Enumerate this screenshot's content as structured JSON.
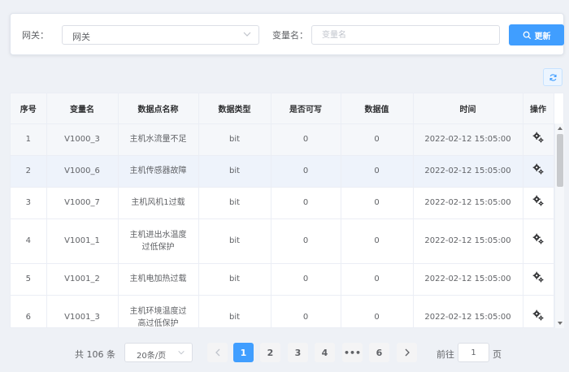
{
  "filter": {
    "gateway_label": "网关：",
    "gateway_value": "网关",
    "var_label": "变量名：",
    "var_placeholder": "变量名",
    "refresh_label": "更新"
  },
  "table": {
    "columns": [
      "序号",
      "变量名",
      "数据点名称",
      "数据类型",
      "是否可写",
      "数据值",
      "时间",
      "操作"
    ],
    "rows": [
      {
        "idx": "1",
        "var": "V1000_3",
        "name_lines": [
          "主机水流量不足"
        ],
        "type": "bit",
        "writable": "0",
        "value": "0",
        "time": "2022-02-12 15:05:00"
      },
      {
        "idx": "2",
        "var": "V1000_6",
        "name_lines": [
          "主机传感器故障"
        ],
        "type": "bit",
        "writable": "0",
        "value": "0",
        "time": "2022-02-12 15:05:00"
      },
      {
        "idx": "3",
        "var": "V1000_7",
        "name_lines": [
          "主机风机1过载"
        ],
        "type": "bit",
        "writable": "0",
        "value": "0",
        "time": "2022-02-12 15:05:00"
      },
      {
        "idx": "4",
        "var": "V1001_1",
        "name_lines": [
          "主机进出水温度",
          "过低保护"
        ],
        "type": "bit",
        "writable": "0",
        "value": "0",
        "time": "2022-02-12 15:05:00"
      },
      {
        "idx": "5",
        "var": "V1001_2",
        "name_lines": [
          "主机电加热过载"
        ],
        "type": "bit",
        "writable": "0",
        "value": "0",
        "time": "2022-02-12 15:05:00"
      },
      {
        "idx": "6",
        "var": "V1001_3",
        "name_lines": [
          "主机环境温度过",
          "高过低保护"
        ],
        "type": "bit",
        "writable": "0",
        "value": "0",
        "time": "2022-02-12 15:05:00"
      }
    ]
  },
  "pagination": {
    "total": "共 106 条",
    "page_size": "20条/页",
    "pages": [
      "1",
      "2",
      "3",
      "4",
      "•••",
      "6"
    ],
    "current": "1",
    "goto_label": "前往",
    "goto_value": "1",
    "goto_suffix": "页"
  },
  "colors": {
    "accent": "#409eff",
    "header_bg": "#f5f7fa"
  }
}
